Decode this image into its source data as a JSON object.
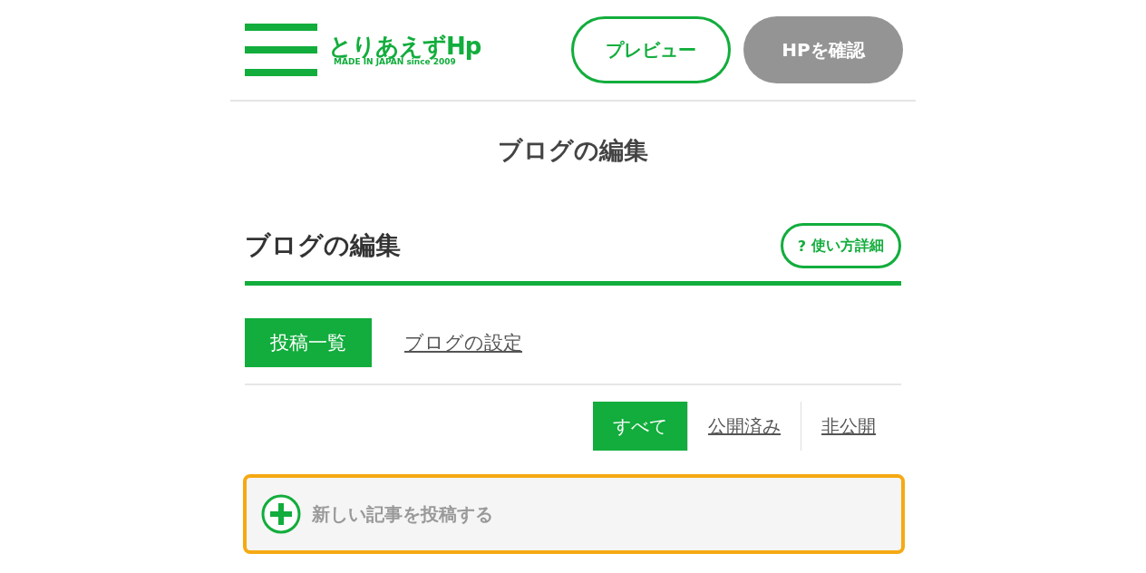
{
  "header": {
    "logo": {
      "title": "とりあえずHp",
      "tagline": "MADE IN JAPAN since 2009"
    },
    "buttons": [
      {
        "label": "プレビュー",
        "disabled": false
      },
      {
        "label": "HPを確認",
        "disabled": true
      }
    ]
  },
  "page_title": "ブログの編集",
  "section": {
    "title": "ブログの編集",
    "help_button": {
      "icon": "?",
      "label": "使い方詳細"
    }
  },
  "tabs": [
    {
      "label": "投稿一覧",
      "selected": true
    },
    {
      "label": "ブログの設定",
      "selected": false
    }
  ],
  "filters": [
    {
      "label": "すべて",
      "selected": true
    },
    {
      "label": "公開済み",
      "selected": false
    },
    {
      "label": "非公開",
      "selected": false
    }
  ],
  "new_post": {
    "label": "新しい記事を投稿する"
  }
}
